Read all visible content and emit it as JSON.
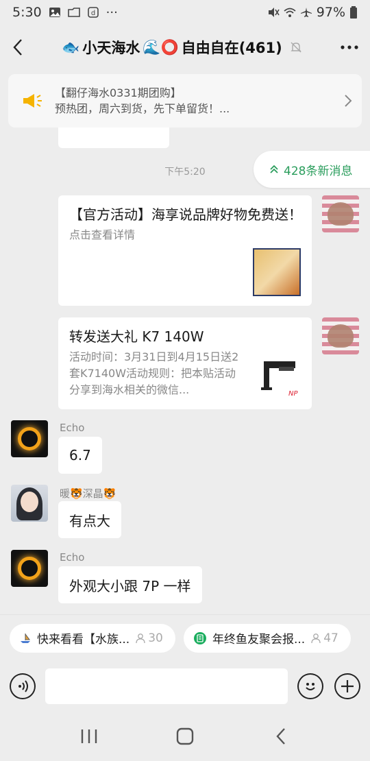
{
  "status": {
    "time": "5:30",
    "battery": "97%",
    "icons": [
      "gallery-icon",
      "folder-icon",
      "app-icon",
      "more-dots-icon",
      "mute-icon",
      "wifi-icon",
      "airplane-icon",
      "battery-icon"
    ],
    "dots": "···"
  },
  "header": {
    "title_prefix": "🐟",
    "title_mid": "小天海水",
    "title_emoji": "🌊⭕",
    "title_suffix": "自由自在(461)"
  },
  "announcement": {
    "line1": "【翻仔海水0331期团购】",
    "line2": "预热团，周六到货，先下单留货！..."
  },
  "chat": {
    "timestamp": "下午5:20",
    "new_messages": "428条新消息",
    "card1": {
      "title": "【官方活动】海享说品牌好物免费送！",
      "desc": "点击查看详情"
    },
    "card2": {
      "title": "转发送大礼 K7 140W",
      "desc": "活动时间：3月31日到4月15日送2套K7140W活动规则：把本贴活动分享到海水相关的微信..."
    },
    "messages": [
      {
        "sender": "Echo",
        "text": "6.7"
      },
      {
        "sender": "暖🐯深晶🐯",
        "text": "有点大"
      },
      {
        "sender": "Echo",
        "text": "外观大小跟 7P 一样"
      }
    ]
  },
  "chips": [
    {
      "label": "快来看看【水族...",
      "count": "30"
    },
    {
      "label": "年终鱼友聚会报...",
      "count": "47"
    }
  ],
  "input": {
    "placeholder": ""
  }
}
